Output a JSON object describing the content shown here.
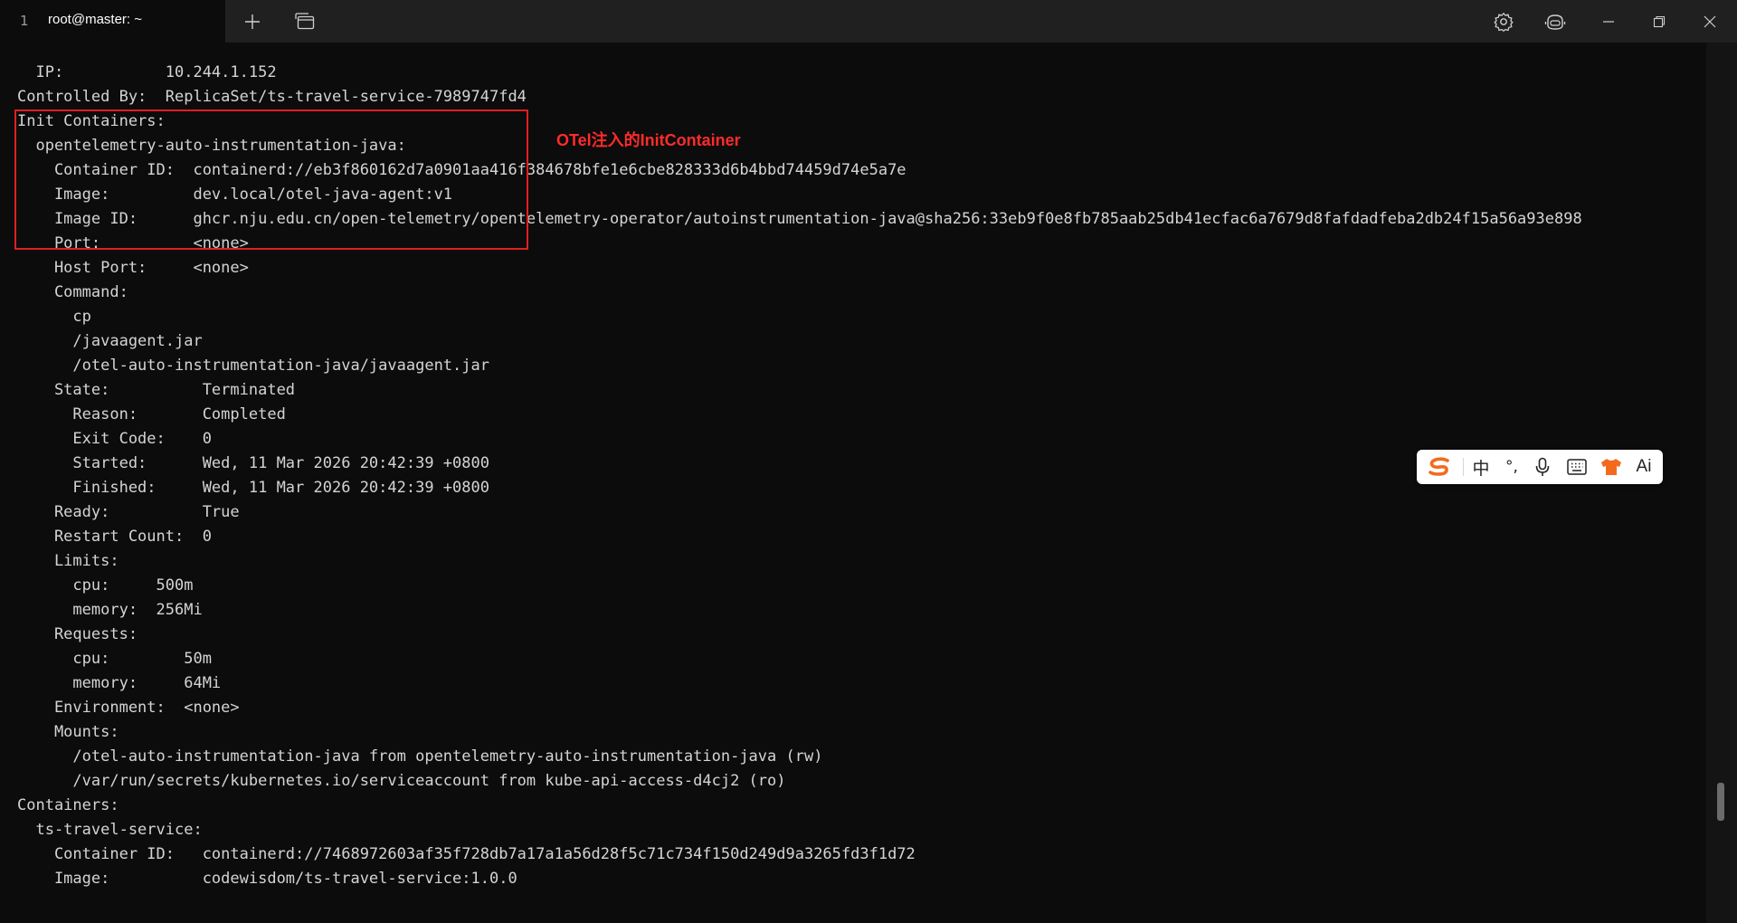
{
  "window": {
    "tab_index": "1",
    "tab_title": "root@master: ~",
    "icons": [
      "plus-icon",
      "new-window-icon",
      "gear-icon",
      "copilot-icon",
      "minimize-icon",
      "maximize-icon",
      "close-icon"
    ]
  },
  "terminal": {
    "lines": [
      "  IP:           10.244.1.152",
      "Controlled By:  ReplicaSet/ts-travel-service-7989747fd4",
      "Init Containers:",
      "  opentelemetry-auto-instrumentation-java:",
      "    Container ID:  containerd://eb3f860162d7a0901aa416f384678bfe1e6cbe828333d6b4bbd74459d74e5a7e",
      "    Image:         dev.local/otel-java-agent:v1",
      "    Image ID:      ghcr.nju.edu.cn/open-telemetry/opentelemetry-operator/autoinstrumentation-java@sha256:33eb9f0e8fb785aab25db41ecfac6a7679d8fafdadfeba2db24f15a56a93e898",
      "    Port:          <none>",
      "    Host Port:     <none>",
      "    Command:",
      "      cp",
      "      /javaagent.jar",
      "      /otel-auto-instrumentation-java/javaagent.jar",
      "    State:          Terminated",
      "      Reason:       Completed",
      "      Exit Code:    0",
      "      Started:      Wed, 11 Mar 2026 20:42:39 +0800",
      "      Finished:     Wed, 11 Mar 2026 20:42:39 +0800",
      "    Ready:          True",
      "    Restart Count:  0",
      "    Limits:",
      "      cpu:     500m",
      "      memory:  256Mi",
      "    Requests:",
      "      cpu:        50m",
      "      memory:     64Mi",
      "    Environment:  <none>",
      "    Mounts:",
      "      /otel-auto-instrumentation-java from opentelemetry-auto-instrumentation-java (rw)",
      "      /var/run/secrets/kubernetes.io/serviceaccount from kube-api-access-d4cj2 (ro)",
      "Containers:",
      "  ts-travel-service:",
      "    Container ID:   containerd://7468972603af35f728db7a17a1a56d28f5c71c734f150d249d9a3265fd3f1d72",
      "    Image:          codewisdom/ts-travel-service:1.0.0"
    ]
  },
  "annotation": {
    "label": "OTel注入的InitContainer",
    "color": "#e02020"
  },
  "ime_toolbar": {
    "items": [
      "sogou-logo-icon",
      "中",
      "°,",
      "microphone-icon",
      "keyboard-icon",
      "skin-icon",
      "Ai"
    ],
    "chinese_mode": "中",
    "punctuation": "°,",
    "ai_label": "Ai"
  },
  "colors": {
    "terminal_bg": "#0c0c0c",
    "titlebar_bg": "#202020",
    "text": "#d4d4d4",
    "annotation": "#ff2b2b",
    "sogou_orange": "#f46a1d"
  }
}
